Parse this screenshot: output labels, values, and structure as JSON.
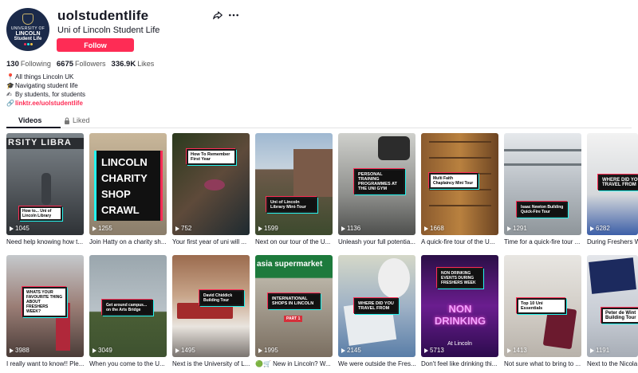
{
  "profile": {
    "username": "uolstudentlife",
    "display_name": "Uni of Lincoln Student Life",
    "follow_label": "Follow",
    "avatar": {
      "line1": "UNIVERSITY OF",
      "line2": "LINCOLN",
      "line3": "Student Life"
    },
    "stats": [
      {
        "value": "130",
        "label": "Following"
      },
      {
        "value": "6675",
        "label": "Followers"
      },
      {
        "value": "336.9K",
        "label": "Likes"
      }
    ],
    "bio": [
      {
        "icon": "map-pin-icon",
        "text": "All things Lincoln UK"
      },
      {
        "icon": "graduation-cap-icon",
        "text": "Navigating student life"
      },
      {
        "icon": "writing-hand-icon",
        "text": "By students, for students"
      }
    ],
    "link": "linktr.ee/uolstudentlife"
  },
  "tabs": {
    "videos": "Videos",
    "liked": "Liked"
  },
  "colors": {
    "accent": "#fe2c55",
    "cyan": "#25f4ee",
    "text": "#161823"
  },
  "videos": [
    {
      "views": "1045",
      "caption": "Need help knowing how t...",
      "sticker": "How to... Uni of Lincoln Library",
      "overlay": "RSITY LIBRA"
    },
    {
      "views": "1255",
      "caption": "Join Hatty on a charity sh...",
      "title": "LINCOLN CHARITY SHOP CRAWL"
    },
    {
      "views": "752",
      "caption": "Your first year of uni will ...",
      "sticker": "How To Remember First Year"
    },
    {
      "views": "1599",
      "caption": "Next on our tour of the U...",
      "sticker": "Uni of Lincoln Library Mini-Tour"
    },
    {
      "views": "1136",
      "caption": "Unleash your full potentia...",
      "sticker": "PERSONAL TRAINING PROGRAMMES AT THE UNI GYM"
    },
    {
      "views": "1668",
      "caption": "A quick-fire tour of the U...",
      "sticker": "Multi Faith Chaplaincy Mini Tour"
    },
    {
      "views": "1291",
      "caption": "Time for a quick-fire tour ...",
      "sticker": "Isaac Newton Building Quick-Fire Tour"
    },
    {
      "views": "6282",
      "caption": "During Freshers W",
      "sticker": "WHERE DID YOU TRAVEL FROM"
    },
    {
      "views": "3988",
      "caption": "I really want to know!! Ple...",
      "sticker": "WHATS YOUR FAVOURITE THING ABOUT FRESHERS WEEK?"
    },
    {
      "views": "3049",
      "caption": "When you come to the U...",
      "sticker": "Get around campus... on the Arts Bridge"
    },
    {
      "views": "1495",
      "caption": "Next is the University of L...",
      "sticker": "David Chiddick Building Tour"
    },
    {
      "views": "1995",
      "caption": "🟢🛒 New in Lincoln? W...",
      "sticker": "INTERNATIONAL SHOPS IN LINCOLN",
      "overlay": "asia supermarket"
    },
    {
      "views": "2145",
      "caption": "We were outside the Fres...",
      "sticker": "WHERE DID YOU TRAVEL FROM"
    },
    {
      "views": "5713",
      "caption": "Don't feel like drinking thi...",
      "sticker": "NON DRINKING EVENTS DURING FRESHERS WEEK",
      "overlay": "At Lincoln"
    },
    {
      "views": "1413",
      "caption": "Not sure what to bring to ...",
      "sticker": "Top 10 Uni Essentials"
    },
    {
      "views": "1191",
      "caption": "Next to the Nicola",
      "sticker": "Peter de Wint Building Tour"
    }
  ]
}
